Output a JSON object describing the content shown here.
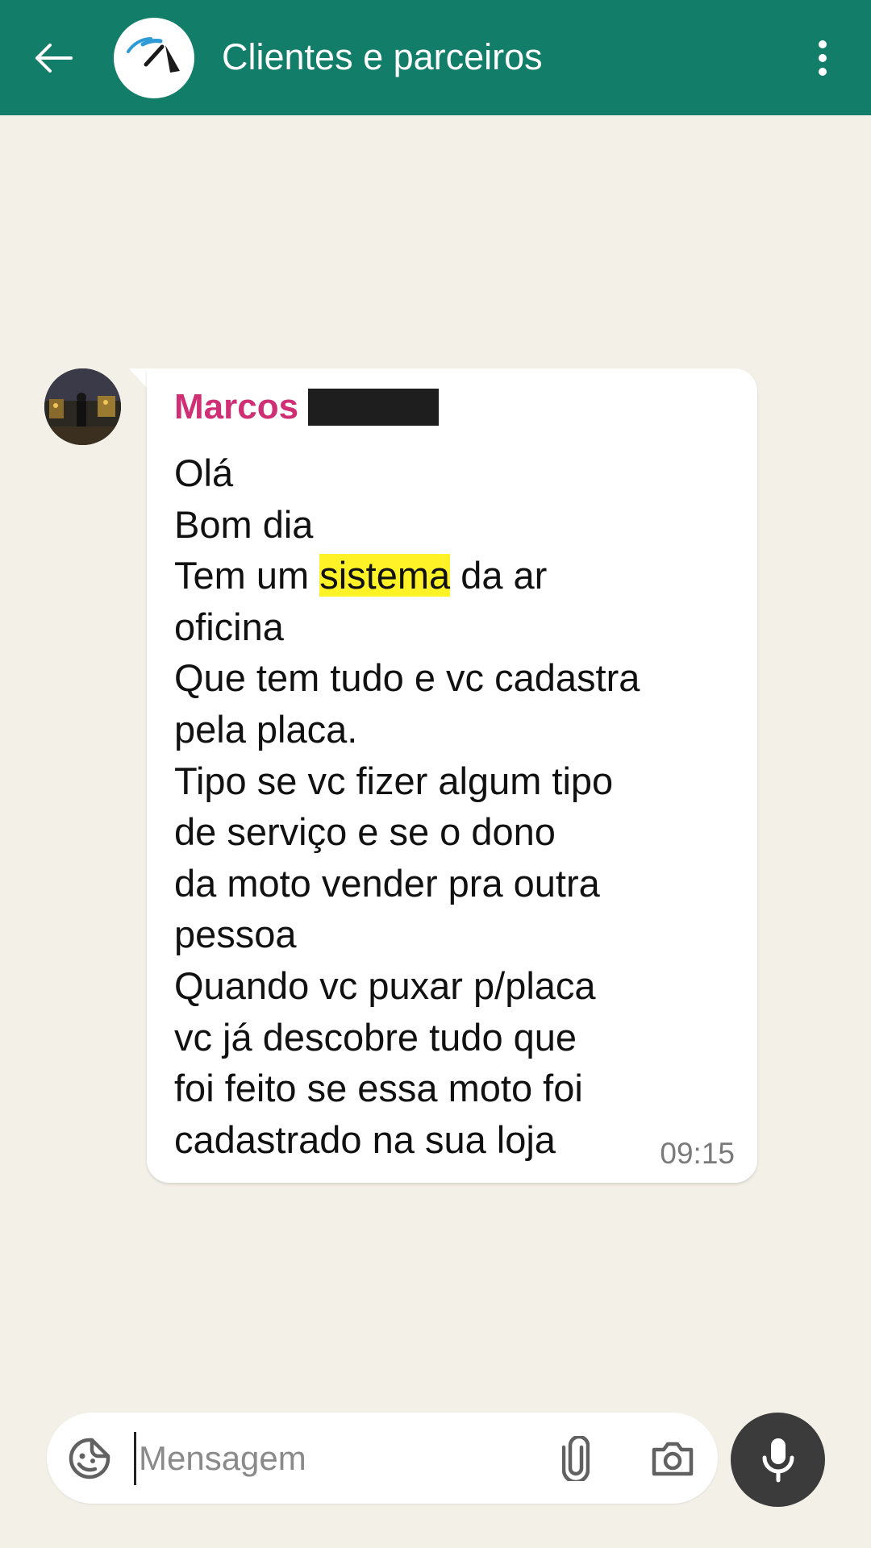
{
  "header": {
    "title": "Clientes e parceiros",
    "back_icon": "arrow-left-icon",
    "avatar_icon": "speedometer-icon",
    "menu_icon": "more-vertical-icon",
    "background_color": "#127d68"
  },
  "message": {
    "sender_name": "Marcos",
    "time": "09:15",
    "lines": [
      "Olá",
      "Bom dia",
      "Tem um ",
      "sistema",
      " da ar",
      "oficina",
      "Que tem tudo e vc cadastra",
      "pela placa.",
      "Tipo se vc fizer algum tipo",
      "de serviço e se o dono",
      "da moto vender pra outra",
      "pessoa",
      "Quando vc puxar p/placa",
      "vc já descobre tudo que",
      "foi feito se essa moto foi",
      "cadastrado na sua loja"
    ],
    "sender_name_color": "#cf2f74",
    "highlight_color": "#fff226"
  },
  "composer": {
    "placeholder": "Mensagem",
    "emoji_icon": "sticker-icon",
    "attach_icon": "paperclip-icon",
    "camera_icon": "camera-icon",
    "mic_icon": "microphone-icon"
  }
}
